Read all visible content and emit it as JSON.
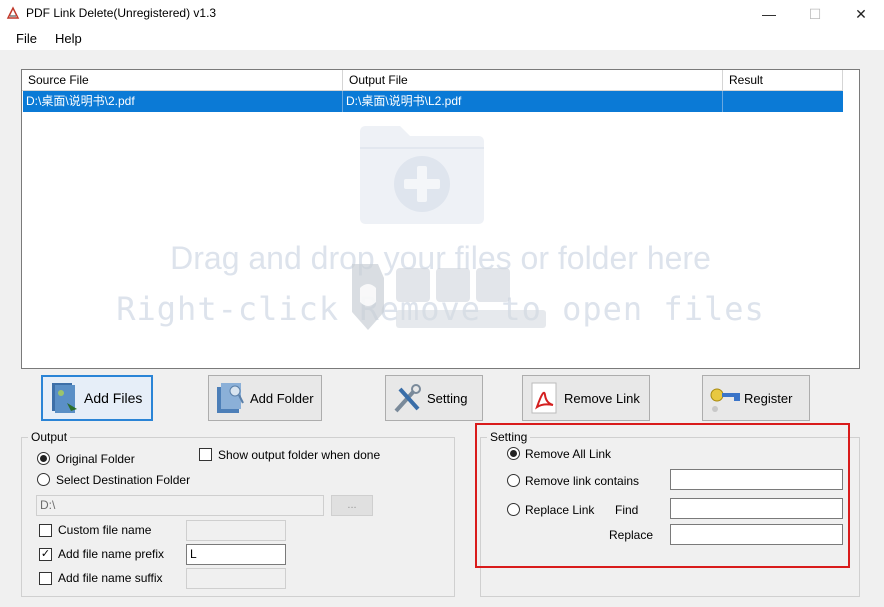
{
  "window": {
    "title": "PDF Link Delete(Unregistered) v1.3",
    "minimize": "—",
    "maximize": "☐",
    "close": "✕"
  },
  "menu": {
    "file": "File",
    "help": "Help"
  },
  "table": {
    "headers": {
      "source": "Source File",
      "output": "Output File",
      "result": "Result"
    },
    "rows": [
      {
        "source": "D:\\桌面\\说明书\\2.pdf",
        "output": "D:\\桌面\\说明书\\L2.pdf",
        "result": ""
      }
    ],
    "drop_hint_1": "Drag and drop your files or folder here",
    "drop_hint_2": "Right-click Remove to open files"
  },
  "toolbar": {
    "add_files": "Add Files",
    "add_folder": "Add Folder",
    "setting": "Setting",
    "remove_link": "Remove Link",
    "register": "Register"
  },
  "output": {
    "group_label": "Output",
    "original_folder": "Original Folder",
    "select_destination": "Select Destination Folder",
    "show_when_done": "Show output folder when done",
    "destination_value": "D:\\",
    "browse": "...",
    "custom_name": "Custom file name",
    "custom_name_value": "",
    "prefix_label": "Add file name prefix",
    "prefix_value": "L",
    "suffix_label": "Add file name suffix",
    "suffix_value": ""
  },
  "setting": {
    "group_label": "Setting",
    "remove_all": "Remove All Link",
    "remove_contains": "Remove link contains",
    "replace_link": "Replace Link",
    "find_label": "Find",
    "replace_label": "Replace",
    "contains_value": "",
    "find_value": "",
    "replace_value": ""
  },
  "colors": {
    "selection": "#0b7ad6",
    "highlight_box": "#d91b1b",
    "focus_border": "#2a84d6"
  }
}
